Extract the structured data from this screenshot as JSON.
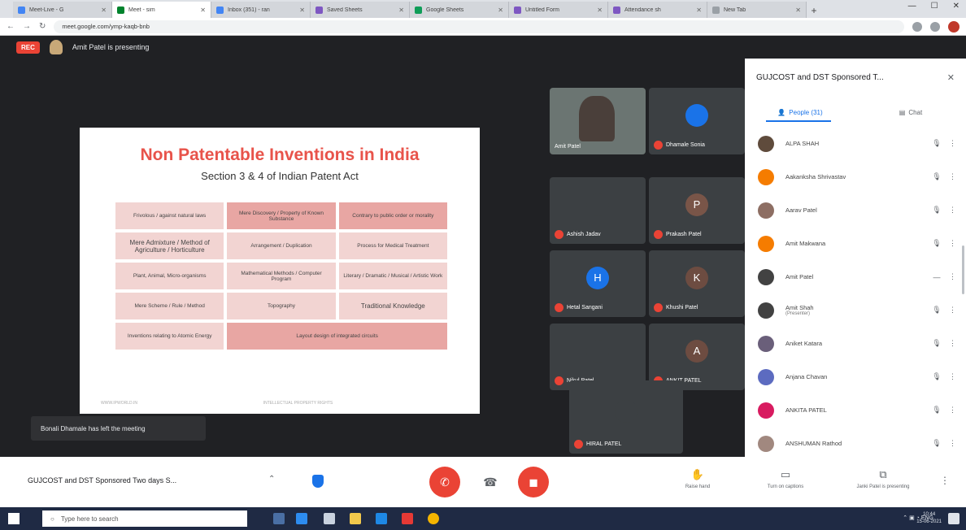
{
  "browser": {
    "tabs": [
      {
        "label": "Meet-Live - G",
        "active": false,
        "color": "#4285f4"
      },
      {
        "label": "Meet - sim",
        "active": true,
        "color": "#00832d"
      },
      {
        "label": "Inbox (351) - ran",
        "active": false,
        "color": "#4285f4"
      },
      {
        "label": "Saved Sheets",
        "active": false,
        "color": "#7e57c2"
      },
      {
        "label": "Google Sheets",
        "active": false,
        "color": "#0f9d58"
      },
      {
        "label": "Untitled Form",
        "active": false,
        "color": "#7e57c2"
      },
      {
        "label": "Attendance sh",
        "active": false,
        "color": "#7e57c2"
      },
      {
        "label": "New Tab",
        "active": false,
        "color": "#9aa0a6"
      }
    ],
    "url": "meet.google.com/ymp-kaqb-bnb"
  },
  "meet": {
    "rec_label": "REC",
    "presenting_text": "Amit Patel is presenting",
    "toast": "Bonali Dhamale has left the meeting",
    "slide": {
      "title": "Non Patentable Inventions in India",
      "subtitle": "Section 3 & 4 of Indian Patent Act",
      "cells": [
        "Frivolous / against natural laws",
        "Mere Discovery / Property of Known Substance",
        "Contrary to public order or morality",
        "Mere Admixture / Method of Agriculture / Horticulture",
        "Arrangement / Duplication",
        "Process for Medical Treatment",
        "Plant, Animal, Micro-organisms",
        "Mathematical Methods / Computer Program",
        "Literary / Dramatic / Musical / Artistic Work",
        "Mere Scheme / Rule / Method",
        "Topography",
        "Traditional Knowledge",
        "Inventions relating to Atomic Energy",
        "Layout design of integrated circuits"
      ],
      "foot_left": "WWW.IPWORLD.IN",
      "foot_mid": "INTELLECTUAL PROPERTY RIGHTS"
    },
    "tiles": [
      {
        "name": "Amit Patel",
        "initial": "",
        "color": "#6b7572"
      },
      {
        "name": "Dhamale Sonia",
        "initial": "",
        "color": "#1a73e8"
      },
      {
        "name": "Ashish Jadav",
        "initial": "",
        "color": "#3c4043"
      },
      {
        "name": "Prakash Patel",
        "initial": "P",
        "color": "#795548"
      },
      {
        "name": "Hetal Sangani",
        "initial": "H",
        "color": "#1a73e8"
      },
      {
        "name": "Khushi Patel",
        "initial": "K",
        "color": "#6d4c41"
      },
      {
        "name": "Nikul Patel",
        "initial": "",
        "color": "#3c4043"
      },
      {
        "name": "ANKIT PATEL",
        "initial": "A",
        "color": "#6d4c41"
      },
      {
        "name": "HIRAL PATEL",
        "initial": "",
        "color": "#3c4043"
      }
    ],
    "meeting_title": "GUJCOST and DST Sponsored Two days S..."
  },
  "panel": {
    "title": "GUJCOST and DST Sponsored T...",
    "tab_people": "People (31)",
    "tab_chat": "Chat",
    "people": [
      {
        "name": "ALPA SHAH",
        "color": "#5f4b3c",
        "initial": ""
      },
      {
        "name": "Aakanksha Shrivastav",
        "color": "#f57c00",
        "initial": ""
      },
      {
        "name": "Aarav Patel",
        "color": "#8d6e63",
        "initial": ""
      },
      {
        "name": "Amit Makwana",
        "color": "#f57c00",
        "initial": ""
      },
      {
        "name": "Amit Patel",
        "color": "#424242",
        "initial": ""
      },
      {
        "name": "Amit Shah",
        "sub": "(Presenter)",
        "color": "#424242",
        "initial": ""
      },
      {
        "name": "Aniket Katara",
        "color": "#6a5f7a",
        "initial": ""
      },
      {
        "name": "Anjana Chavan",
        "color": "#5c6bc0",
        "initial": ""
      },
      {
        "name": "ANKITA PATEL",
        "color": "#d81b60",
        "initial": ""
      },
      {
        "name": "ANSHUMAN Rathod",
        "color": "#a1887f",
        "initial": ""
      }
    ]
  },
  "controls": {
    "hand_label": "Raise hand",
    "captions_label": "Turn on captions",
    "present_label": "Janki Patel is presenting"
  },
  "taskbar": {
    "search_placeholder": "Type here to search",
    "time": "10:44",
    "date": "15-06-2021"
  },
  "colors": {
    "danger": "#ea4335",
    "accent": "#1a73e8",
    "slide_title": "#e8534a"
  }
}
